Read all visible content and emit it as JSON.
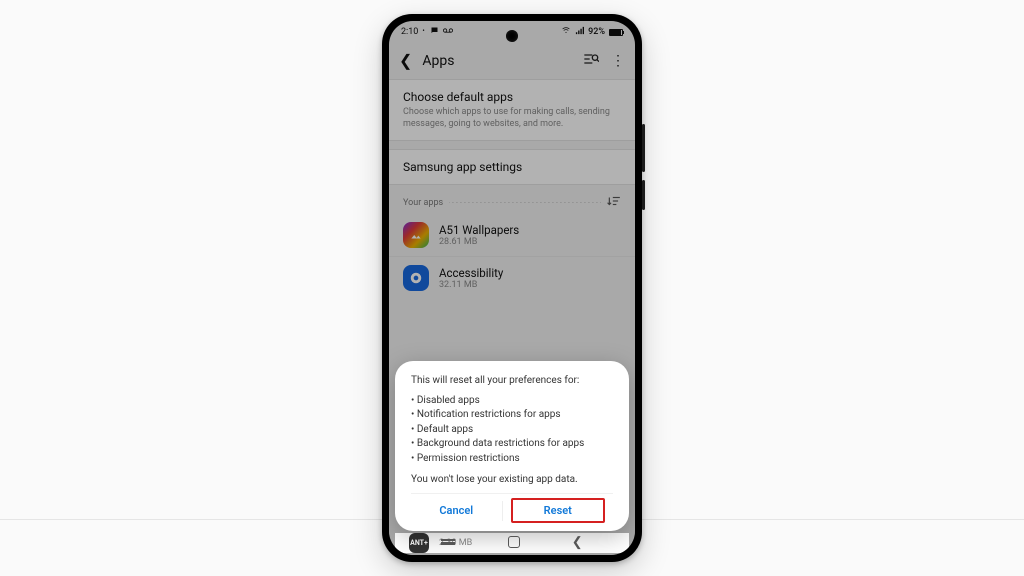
{
  "statusbar": {
    "time": "2:10",
    "battery_pct": "92%"
  },
  "header": {
    "title": "Apps"
  },
  "sections": {
    "default_apps": {
      "title": "Choose default apps",
      "sub": "Choose which apps to use for making calls, sending messages, going to websites, and more."
    },
    "samsung": {
      "title": "Samsung app settings"
    }
  },
  "list_header": {
    "label": "Your apps"
  },
  "apps": [
    {
      "name": "A51 Wallpapers",
      "size": "28.61 MB"
    },
    {
      "name": "Accessibility",
      "size": "32.11 MB"
    }
  ],
  "peek": {
    "label": "ANT+",
    "size": "2.30 MB"
  },
  "dialog": {
    "lead": "This will reset all your preferences for:",
    "items": [
      "Disabled apps",
      "Notification restrictions for apps",
      "Default apps",
      "Background data restrictions for apps",
      "Permission restrictions"
    ],
    "trail": "You won't lose your existing app data.",
    "cancel": "Cancel",
    "reset": "Reset"
  }
}
